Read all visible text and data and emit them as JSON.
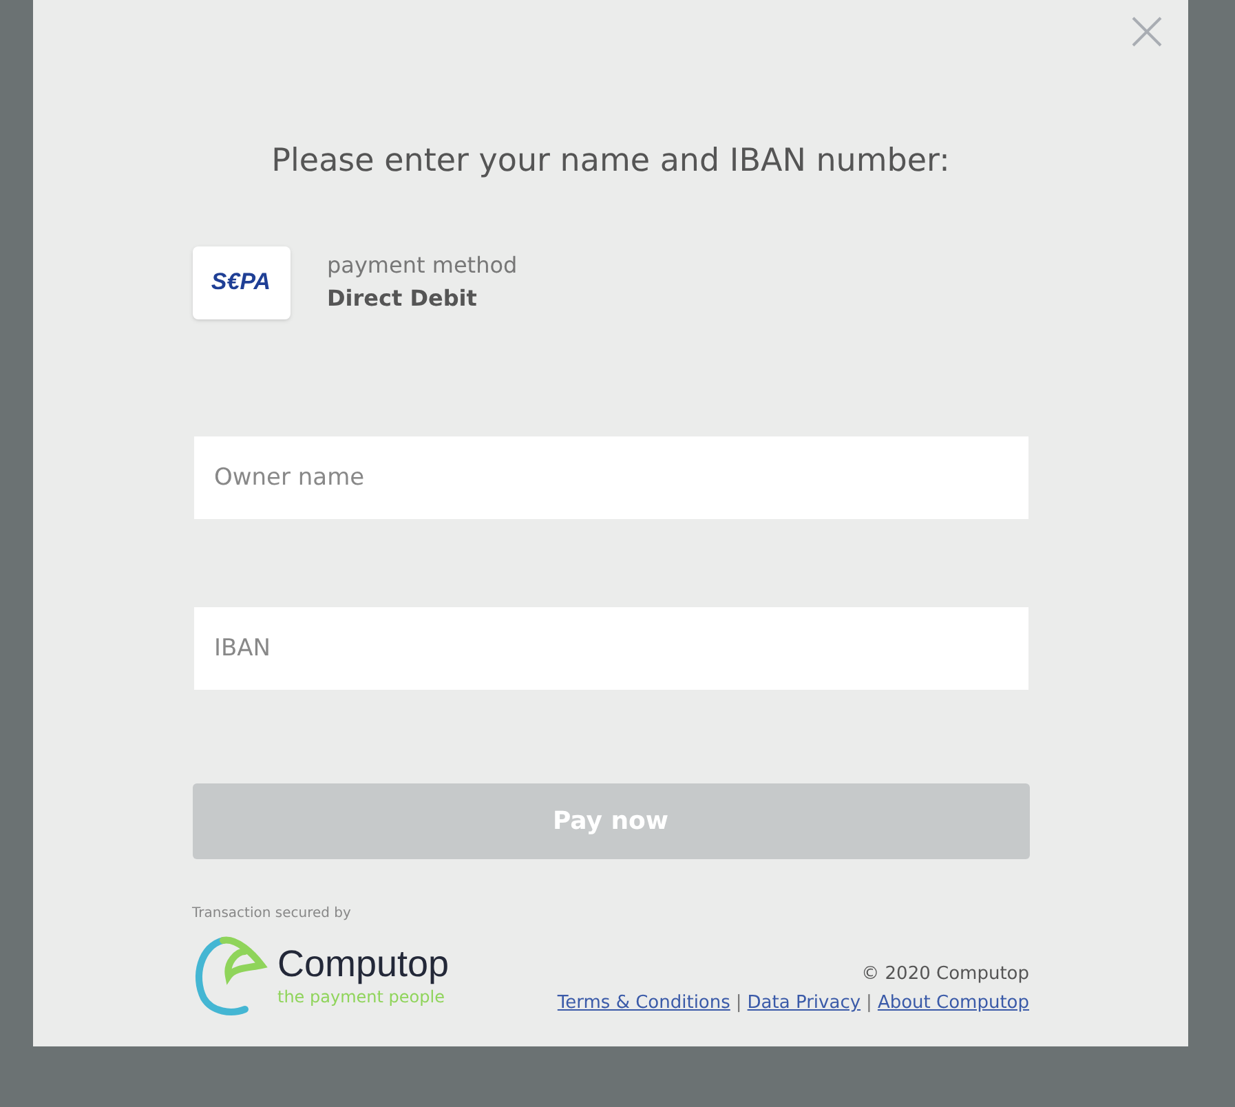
{
  "title": "Please enter your name and IBAN number:",
  "payment": {
    "logo": "S€PA",
    "label": "payment method",
    "method": "Direct Debit"
  },
  "fields": [
    {
      "placeholder": "Owner name"
    },
    {
      "placeholder": "IBAN"
    }
  ],
  "pay_button": {
    "label": "Pay now",
    "disabled": true
  },
  "footer": {
    "secured_by": "Transaction secured by",
    "brand": "Computop",
    "tagline": "the payment people",
    "copyright": "© 2020 Computop",
    "links": [
      {
        "label": "Terms & Conditions"
      },
      {
        "label": "Data Privacy"
      },
      {
        "label": "About Computop"
      }
    ],
    "separator": "|"
  }
}
